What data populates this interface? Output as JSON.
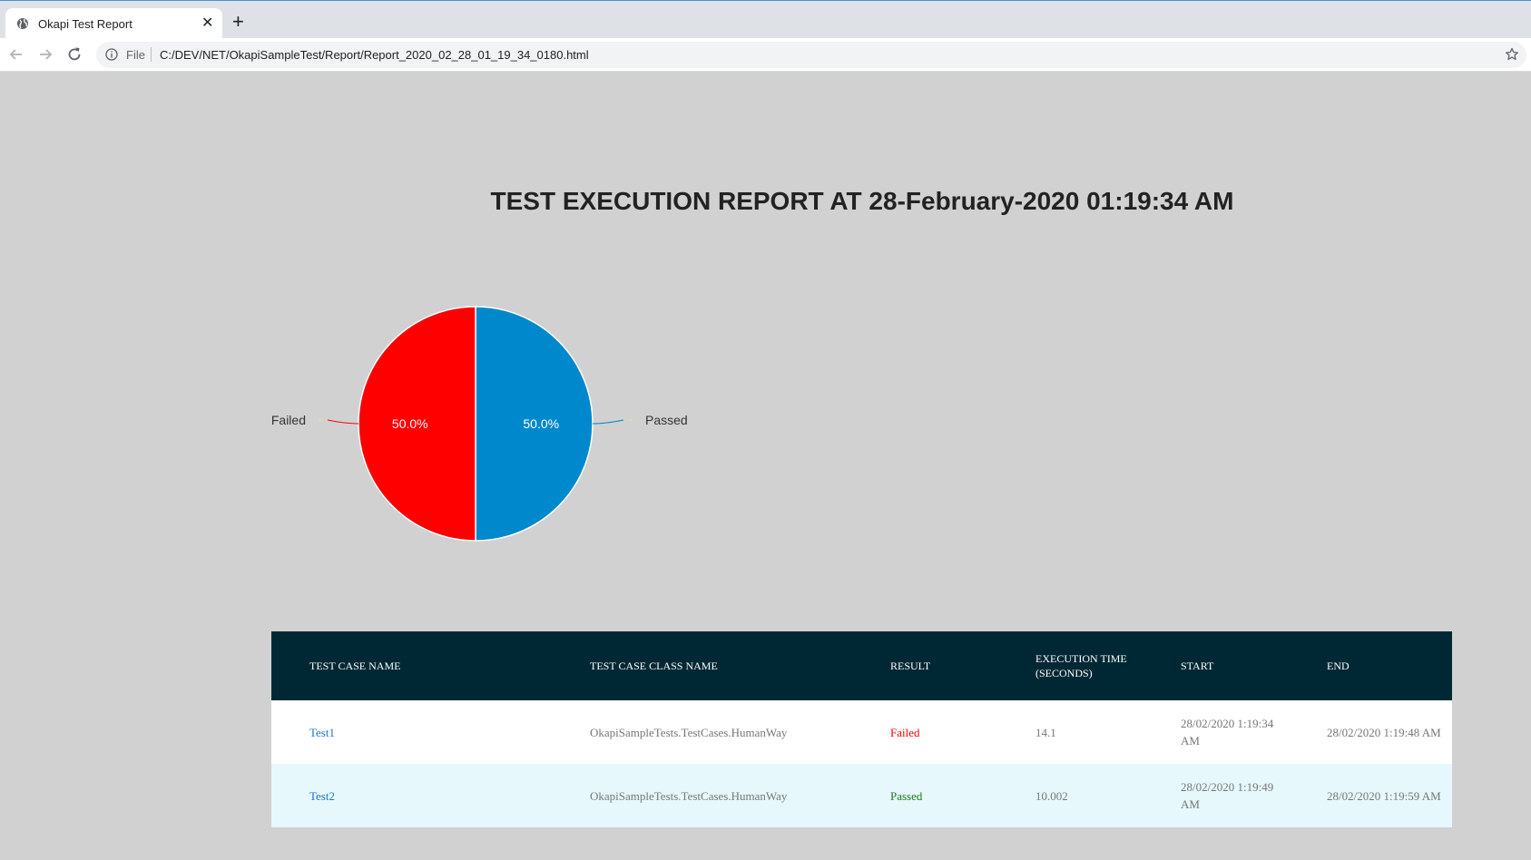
{
  "browser": {
    "tab_title": "Okapi Test Report",
    "close_glyph": "✕",
    "new_tab_glyph": "+",
    "scheme_label": "File",
    "url": "C:/DEV/NET/OkapiSampleTest/Report/Report_2020_02_28_01_19_34_0180.html"
  },
  "report": {
    "title": "TEST EXECUTION REPORT AT 28-February-2020 01:19:34 AM"
  },
  "colors": {
    "failed": "#ff0000",
    "passed": "#0088cc",
    "link": "#1a73d9",
    "header_bg": "#002834",
    "page_bg": "#d1d1d1"
  },
  "chart_data": {
    "type": "pie",
    "slices": [
      {
        "label": "Passed",
        "value": 50.0,
        "display": "50.0%",
        "color": "#0088cc"
      },
      {
        "label": "Failed",
        "value": 50.0,
        "display": "50.0%",
        "color": "#ff0000"
      }
    ]
  },
  "table": {
    "headers": [
      "TEST CASE NAME",
      "TEST CASE CLASS NAME",
      "RESULT",
      "EXECUTION TIME (SECONDS)",
      "START",
      "END"
    ],
    "rows": [
      {
        "name": "Test1",
        "class_name": "OkapiSampleTests.TestCases.HumanWay",
        "result": "Failed",
        "time": "14.1",
        "start": "28/02/2020 1:19:34 AM",
        "end": "28/02/2020 1:19:48 AM"
      },
      {
        "name": "Test2",
        "class_name": "OkapiSampleTests.TestCases.HumanWay",
        "result": "Passed",
        "time": "10.002",
        "start": "28/02/2020 1:19:49 AM",
        "end": "28/02/2020 1:19:59 AM"
      }
    ]
  }
}
